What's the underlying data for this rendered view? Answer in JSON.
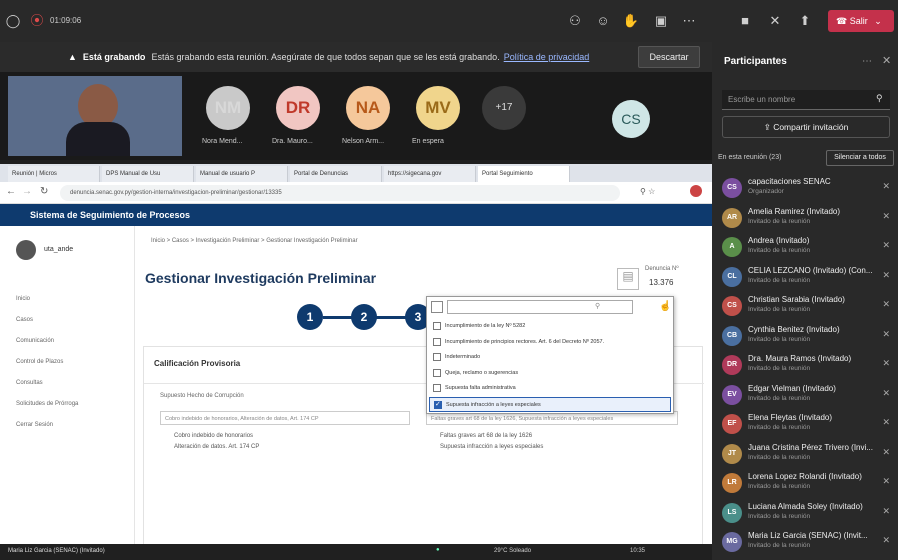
{
  "meeting": {
    "time": "01:09:06",
    "leave_label": "Salir"
  },
  "recording": {
    "bold": "Está grabando",
    "text": "Estás grabando esta reunión. Asegúrate de que todos sepan que se les está grabando.",
    "link": "Política de privacidad",
    "discard": "Descartar"
  },
  "video": {
    "tiles": [
      {
        "initials": "NM",
        "name": "Nora Mend...",
        "color": "#d8d8d8",
        "bg": "#c9c9c9"
      },
      {
        "initials": "DR",
        "name": "Dra. Mauro...",
        "color": "#c0392b",
        "bg": "#f1c6c2"
      },
      {
        "initials": "NA",
        "name": "Nelson Arm...",
        "color": "#b7591a",
        "bg": "#f5c89b"
      },
      {
        "initials": "MV",
        "name": "En espera",
        "color": "#9a6a18",
        "bg": "#f0d58c"
      }
    ],
    "more": "+17",
    "cs": "CS"
  },
  "browser": {
    "tabs": [
      "Reunión | Micros",
      "DPS Manual de Usu",
      "Manual de usuario P",
      "Portal de Denuncias",
      "https://sigecana.gov",
      "Portal Seguimiento"
    ],
    "url": "denuncia.senac.gov.py/gestion-interna/investigacion-preliminar/gestionar/13335"
  },
  "app": {
    "system_title": "Sistema de Seguimiento de Procesos",
    "user": "uta_ande",
    "menu": [
      "Inicio",
      "Casos",
      "Comunicación",
      "Control de Plazos",
      "Consultas",
      "Solicitudes de Prórroga",
      "Cerrar Sesión"
    ],
    "breadcrumb": "Inicio  >  Casos  >  Investigación Preliminar  >  Gestionar Investigación Preliminar",
    "page_title": "Gestionar Investigación Preliminar",
    "denuncia_label": "Denuncia Nº",
    "denuncia_number": "13.376",
    "steps": [
      "1",
      "2",
      "3"
    ],
    "section_title": "Calificación Provisoria",
    "field_label": "Supuesto Hecho de Corrupción",
    "left_select": "Cobro indebido de honorarios, Alteración de datos, Art. 174 CP",
    "left_values": [
      "Cobro indebido de honorarios",
      "Alteración de datos. Art. 174 CP"
    ],
    "right_select": "Faltas graves art 68 de la ley 1626, Supuesta infracción a leyes especiales",
    "right_values": [
      "Faltas graves art 68 de la ley 1626",
      "Supuesta infracción a leyes especiales"
    ]
  },
  "dropdown": {
    "items": [
      {
        "label": "Incumplimiento de la ley Nº 5282",
        "checked": false
      },
      {
        "label": "Incumplimiento de principios rectores. Art. 6 del Decreto Nº 2057.",
        "checked": false
      },
      {
        "label": "Indeterminado",
        "checked": false
      },
      {
        "label": "Queja, reclamo o sugerencias",
        "checked": false
      },
      {
        "label": "Supuesta falta administrativa",
        "checked": false
      },
      {
        "label": "Supuesta infracción a leyes especiales",
        "checked": true
      }
    ]
  },
  "taskbar": {
    "user": "Maria Liz Garcia (SENAC) (Invitado)",
    "weather": "29°C Soleado",
    "clock": "10:35"
  },
  "participants": {
    "title": "Participantes",
    "search_placeholder": "Escribe un nombre",
    "share": "Compartir invitación",
    "in_meeting": "En esta reunión (23)",
    "mute_all": "Silenciar a todos",
    "list": [
      {
        "i": "CS",
        "name": "capacitaciones SENAC",
        "role": "Organizador",
        "c": "#7b4fa0"
      },
      {
        "i": "AR",
        "name": "Amelia Ramirez (Invitado)",
        "role": "Invitado de la reunión",
        "c": "#b08a4a"
      },
      {
        "i": "A",
        "name": "Andrea (Invitado)",
        "role": "Invitado de la reunión",
        "c": "#5a8f4a"
      },
      {
        "i": "CL",
        "name": "CELIA LEZCANO (Invitado) (Con...",
        "role": "Invitado de la reunión",
        "c": "#4a6fa0"
      },
      {
        "i": "CS",
        "name": "Christian Sarabia (Invitado)",
        "role": "Invitado de la reunión",
        "c": "#c0504a"
      },
      {
        "i": "CB",
        "name": "Cynthia Benitez (Invitado)",
        "role": "Invitado de la reunión",
        "c": "#4a6fa0"
      },
      {
        "i": "DR",
        "name": "Dra. Maura Ramos (Invitado)",
        "role": "Invitado de la reunión",
        "c": "#b03a5a"
      },
      {
        "i": "EV",
        "name": "Edgar Vielman (Invitado)",
        "role": "Invitado de la reunión",
        "c": "#7b4fa0"
      },
      {
        "i": "EF",
        "name": "Elena Fleytas (Invitado)",
        "role": "Invitado de la reunión",
        "c": "#c0504a"
      },
      {
        "i": "JT",
        "name": "Juana Cristina Pérez Trivero (Invi...",
        "role": "Invitado de la reunión",
        "c": "#b08a4a"
      },
      {
        "i": "LR",
        "name": "Lorena Lopez Rolandi (Invitado)",
        "role": "Invitado de la reunión",
        "c": "#c07a3a"
      },
      {
        "i": "LS",
        "name": "Luciana Almada Soley (Invitado)",
        "role": "Invitado de la reunión",
        "c": "#4a8f8a"
      },
      {
        "i": "MG",
        "name": "Maria Liz Garcia (SENAC) (Invit...",
        "role": "Invitado de la reunión",
        "c": "#6a6aa0"
      }
    ]
  }
}
